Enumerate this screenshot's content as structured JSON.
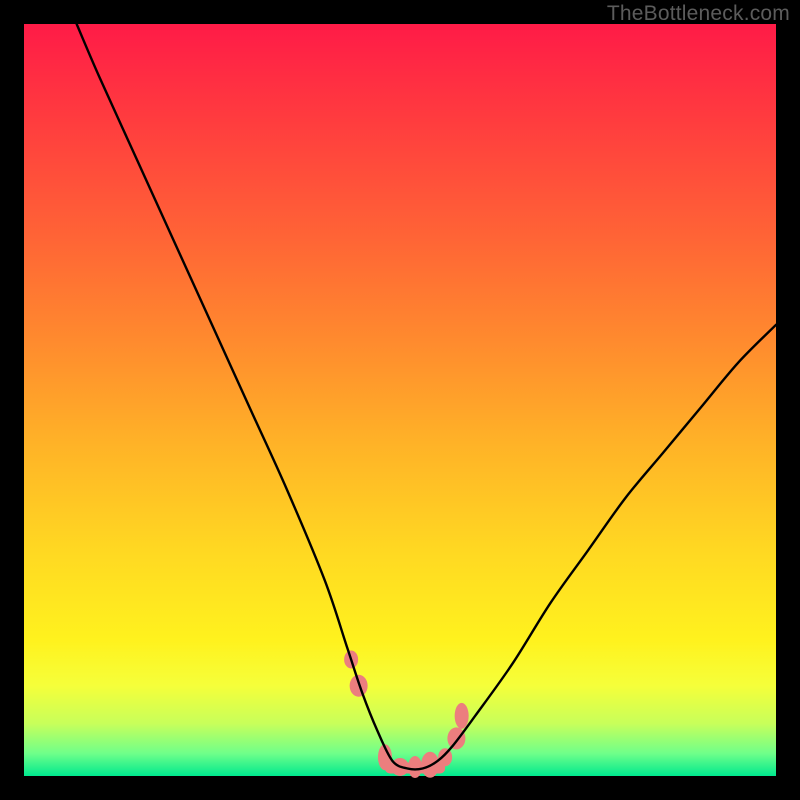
{
  "watermark": "TheBottleneck.com",
  "chart_data": {
    "type": "line",
    "title": "",
    "xlabel": "",
    "ylabel": "",
    "xlim": [
      0,
      100
    ],
    "ylim": [
      0,
      100
    ],
    "grid": false,
    "legend": false,
    "background_gradient": [
      "#ff1b47",
      "#00e98e"
    ],
    "series": [
      {
        "name": "bottleneck-curve",
        "color": "#000000",
        "x": [
          7,
          10,
          15,
          20,
          25,
          30,
          35,
          40,
          43,
          45,
          47,
          49,
          51,
          53,
          55,
          57,
          60,
          65,
          70,
          75,
          80,
          85,
          90,
          95,
          100
        ],
        "y": [
          100,
          93,
          82,
          71,
          60,
          49,
          38,
          26,
          17,
          11,
          6,
          2,
          1,
          1,
          2,
          4,
          8,
          15,
          23,
          30,
          37,
          43,
          49,
          55,
          60
        ]
      }
    ],
    "markers": {
      "name": "highlight-points",
      "color": "#ec7e7e",
      "x": [
        43.5,
        44.5,
        48,
        50,
        52,
        54,
        56,
        57.5,
        58.2
      ],
      "y": [
        15.5,
        12,
        2.5,
        1.2,
        1.2,
        1.5,
        2.5,
        5,
        8
      ]
    }
  }
}
